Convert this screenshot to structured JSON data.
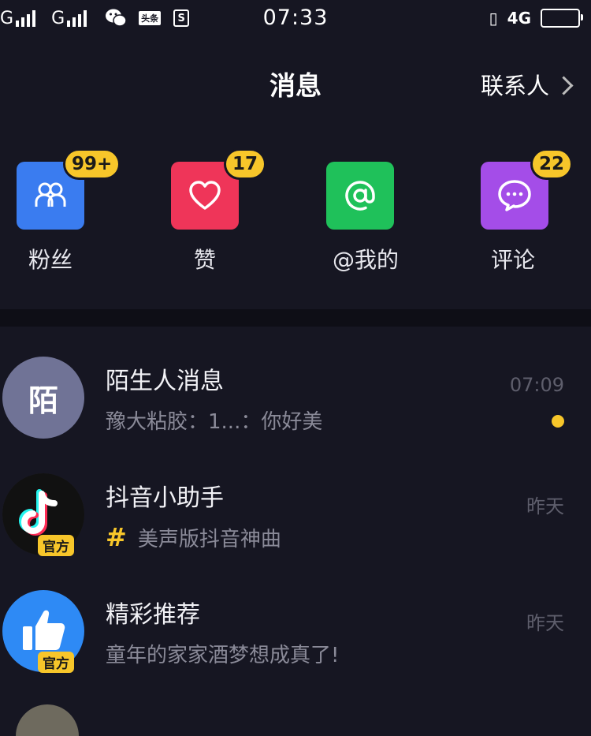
{
  "status_bar": {
    "carrier_1": "G",
    "carrier_2": "G",
    "news_app": "头条",
    "s_app": "S",
    "time": "07:33",
    "network": "4G"
  },
  "header": {
    "title": "消息",
    "contacts_label": "联系人"
  },
  "categories": [
    {
      "label": "粉丝",
      "badge": "99+",
      "icon": "fans-icon",
      "color": "#3a7cf0"
    },
    {
      "label": "赞",
      "badge": "17",
      "icon": "heart-icon",
      "color": "#ef3559"
    },
    {
      "label": "@我的",
      "badge": "",
      "icon": "at-icon",
      "color": "#1fc15a"
    },
    {
      "label": "评论",
      "badge": "22",
      "icon": "comment-icon",
      "color": "#a44de8"
    }
  ],
  "messages": [
    {
      "title": "陌生人消息",
      "subtitle": "豫大粘胶：1...：你好美",
      "time": "07:09",
      "avatar_text": "陌",
      "unread": true
    },
    {
      "title": "抖音小助手",
      "subtitle": "美声版抖音神曲",
      "time": "昨天",
      "official_label": "官方",
      "subtitle_icon": "hashtag-icon"
    },
    {
      "title": "精彩推荐",
      "subtitle": "童年的家家酒梦想成真了!",
      "time": "昨天",
      "official_label": "官方"
    }
  ],
  "colors": {
    "background": "#161622",
    "badge": "#f7c62a",
    "stranger_avatar": "#707396",
    "recommend_avatar": "#2e8af5"
  }
}
